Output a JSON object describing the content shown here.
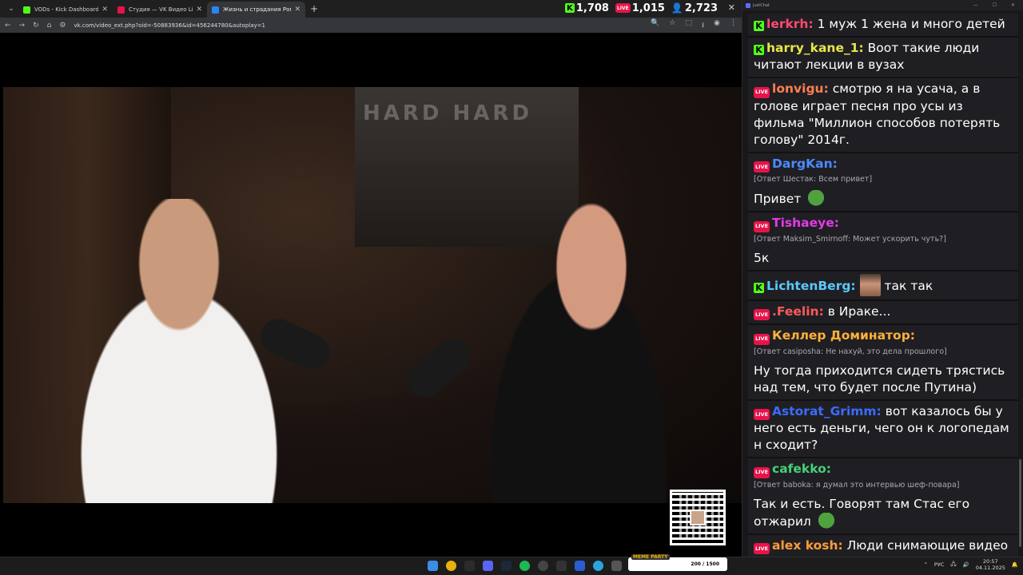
{
  "browser": {
    "tabs": [
      {
        "label": "VODs - Kick Dashboard",
        "color": "#53fc18"
      },
      {
        "label": "Студия — VK Видео Live",
        "color": "#e8134a"
      },
      {
        "label": "Жизнь и страдания Рома",
        "color": "#2787f5"
      }
    ],
    "url": "vk.com/video_ext.php?oid=-50883936&id=456244780&autoplay=1"
  },
  "stats": {
    "kick": "1,708",
    "live_badge": "LIVE",
    "vk": "1,015",
    "viewers": "2,723"
  },
  "chat": {
    "title": "JustChat",
    "messages": [
      {
        "platform": "kick",
        "user": "lerkrh:",
        "color": "#ff4b6e",
        "text": "1 муж 1 жена и много детей"
      },
      {
        "platform": "kick",
        "user": "harry_kane_1:",
        "color": "#e8e64a",
        "text": "Воот такие люди читают лекции в вузах"
      },
      {
        "platform": "live",
        "user": "lonvigu:",
        "color": "#ff7f50",
        "text": "смотрю я на усача, а в голове играет песня про усы из фильма \"Миллион способов потерять голову\" 2014г."
      },
      {
        "platform": "live",
        "user": "DargKan:",
        "color": "#4b8bff",
        "reply": "[Ответ Шестак: Всем привет]",
        "text": "Привет"
      },
      {
        "platform": "live",
        "user": "Tishaeye:",
        "color": "#e23be5",
        "reply": "[Ответ Maksim_Smirnoff: Может ускорить чуть?]",
        "text": "5к"
      },
      {
        "platform": "kick",
        "user": "LichtenBerg:",
        "color": "#5ac8ff",
        "text": "так так"
      },
      {
        "platform": "live",
        "user": ".Feelin:",
        "color": "#ff5a5a",
        "text": "в Ираке..."
      },
      {
        "platform": "live",
        "user": "Келлер Доминатор:",
        "color": "#ffb03a",
        "reply": "[Ответ casiposha: Не нахуй, это дела прошлого]",
        "text": "Ну тогда приходится сидеть трястись над тем, что будет после Путина)"
      },
      {
        "platform": "live",
        "user": "Astorat_Grimm:",
        "color": "#3b6cff",
        "text": "вот казалось бы у него есть деньги, чего он к логопедам н сходит?"
      },
      {
        "platform": "live",
        "user": "cafekko:",
        "color": "#45d17a",
        "reply": "[Ответ baboka: я думал это интервью шеф-повара]",
        "text": "Так и есть. Говорят там Стас его отжарил"
      },
      {
        "platform": "live",
        "user": "alex kosh:",
        "color": "#ff9c3a",
        "text": "Люди снимающие видео для Мелствоя в курсе о ценностях?"
      }
    ]
  },
  "video": {
    "poster_text": "HARD  HARD"
  },
  "taskbar": {
    "overlay_tag": "MEME PARTY",
    "overlay_progress": "200 / 1500",
    "lang": "РУС",
    "time": "20:57",
    "date": "04.11.2025"
  }
}
